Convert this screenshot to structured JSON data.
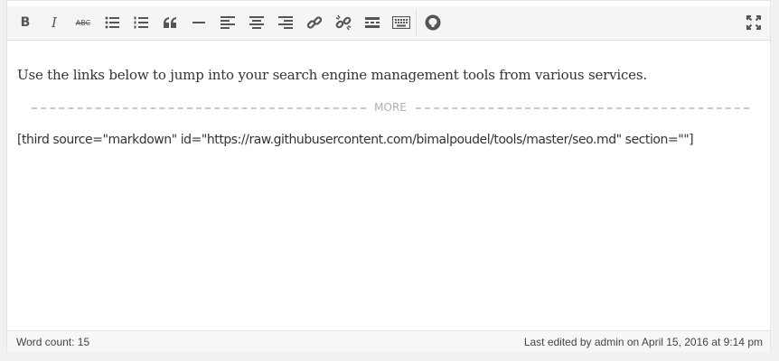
{
  "toolbar": {
    "buttons": [
      {
        "name": "bold-button",
        "label": "B"
      },
      {
        "name": "italic-button",
        "label": "I"
      },
      {
        "name": "strikethrough-button",
        "label": "ABC"
      }
    ]
  },
  "content": {
    "paragraph": "Use the links below to jump into your search engine management tools from various services.",
    "more_label": "MORE",
    "shortcode": "[third source=\"markdown\" id=\"https://raw.githubusercontent.com/bimalpoudel/tools/master/seo.md\" section=\"\"]"
  },
  "status": {
    "word_count": "Word count: 15",
    "last_edited": "Last edited by admin on April 15, 2016 at 9:14 pm"
  },
  "colors": {
    "toolbar_bg": "#f5f5f5",
    "icon": "#555555",
    "more_text": "#b0b0b0"
  }
}
